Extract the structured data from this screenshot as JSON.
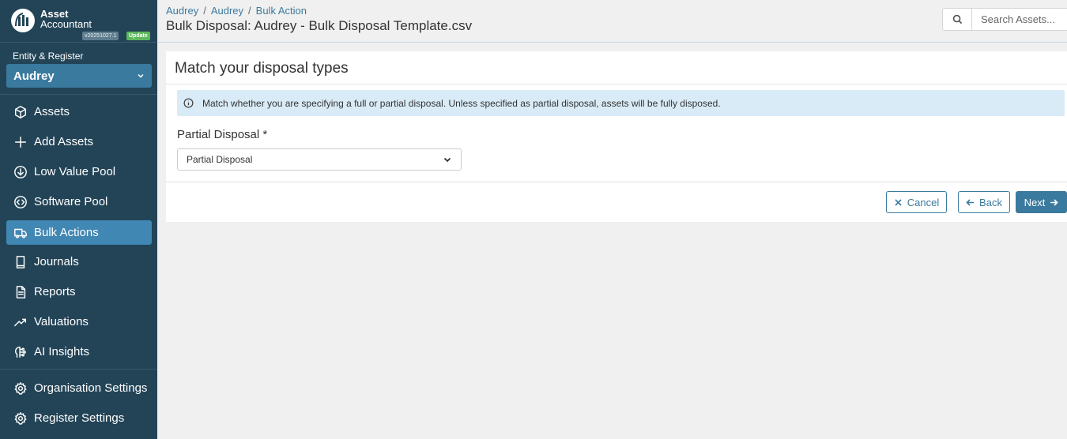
{
  "brand": {
    "name_line1": "Asset",
    "name_line2": "Accountant",
    "version": "v20251027.1",
    "update_label": "Update"
  },
  "entity": {
    "label": "Entity & Register",
    "selected": "Audrey"
  },
  "nav": [
    {
      "label": "Assets",
      "icon": "cube-icon"
    },
    {
      "label": "Add Assets",
      "icon": "plus-icon"
    },
    {
      "label": "Low Value Pool",
      "icon": "arrow-down-circle-icon"
    },
    {
      "label": "Software Pool",
      "icon": "code-circle-icon"
    },
    {
      "label": "Bulk Actions",
      "icon": "truck-icon",
      "active": true
    },
    {
      "label": "Journals",
      "icon": "book-icon"
    },
    {
      "label": "Reports",
      "icon": "document-icon"
    },
    {
      "label": "Valuations",
      "icon": "trending-up-icon"
    },
    {
      "label": "AI Insights",
      "icon": "brain-icon"
    },
    {
      "label": "Organisation Settings",
      "icon": "gear-icon"
    },
    {
      "label": "Register Settings",
      "icon": "gear-icon"
    }
  ],
  "header": {
    "breadcrumb": [
      "Audrey",
      "Audrey",
      "Bulk Action"
    ],
    "breadcrumb_separator": "/",
    "title": "Bulk Disposal: Audrey - Bulk Disposal Template.csv",
    "search_placeholder": "Search Assets..."
  },
  "card": {
    "title": "Match your disposal types",
    "info": "Match whether you are specifying a full or partial disposal. Unless specified as partial disposal, assets will be fully disposed.",
    "field_label": "Partial Disposal *",
    "field_value": "Partial Disposal",
    "cancel_label": "Cancel",
    "back_label": "Back",
    "next_label": "Next"
  },
  "colors": {
    "sidebar": "#234457",
    "accent": "#3a7a9e",
    "active_nav": "#4187b3",
    "info_bg": "#d9ebf6",
    "update_badge": "#5cb85c"
  }
}
